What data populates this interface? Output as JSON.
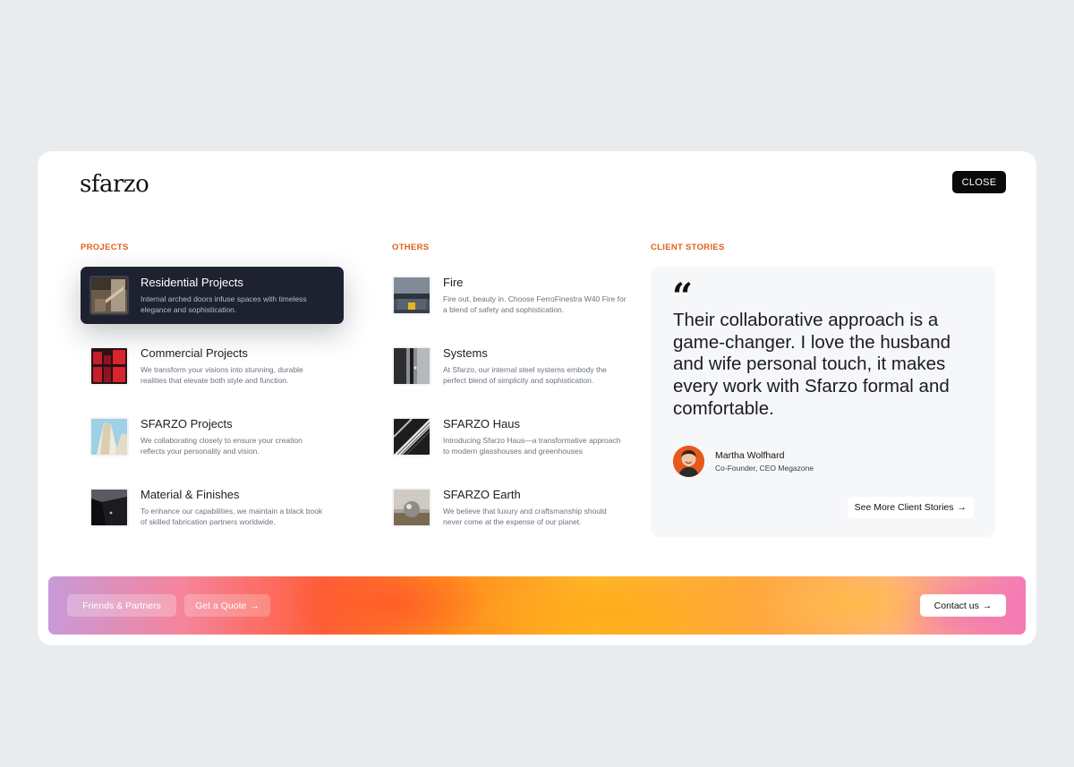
{
  "brand": {
    "logo": "sfarzo"
  },
  "header": {
    "close_label": "CLOSE"
  },
  "projects": {
    "heading": "PROJECTS",
    "items": [
      {
        "title": "Residential Projects",
        "desc": "Internal arched doors infuse spaces with timeless elegance and sophistication.",
        "active": true,
        "icon": "residential-thumb"
      },
      {
        "title": "Commercial Projects",
        "desc": "We transform your visions into stunning, durable realities that elevate both style and function.",
        "icon": "commercial-thumb"
      },
      {
        "title": "SFARZO Projects",
        "desc": "We collaborating closely to ensure your creation reflects your personality and vision.",
        "icon": "sfarzo-projects-thumb"
      },
      {
        "title": "Material & Finishes",
        "desc": "To enhance our capabilities, we maintain a black book of skilled fabrication partners worldwide.",
        "icon": "materials-thumb"
      }
    ]
  },
  "others": {
    "heading": "OTHERS",
    "items": [
      {
        "title": "Fire",
        "desc": "Fire out, beauty in. Choose FerroFinestra W40 Fire for a blend of safety and sophistication.",
        "icon": "fire-thumb"
      },
      {
        "title": "Systems",
        "desc": "At Sfarzo, our internal steel systems embody the perfect blend of simplicity and sophistication.",
        "icon": "systems-thumb"
      },
      {
        "title": "SFARZO Haus",
        "desc": "Introducing Sfarzo Haus—a transformative approach to modern glasshouses and greenhouses",
        "icon": "haus-thumb"
      },
      {
        "title": "SFARZO Earth",
        "desc": "We believe that luxury and craftsmanship should never come at the expense of our planet.",
        "icon": "earth-thumb"
      }
    ]
  },
  "client_stories": {
    "heading": "CLIENT STORIES",
    "quote_mark": "“",
    "quote": "Their collaborative approach is a game-changer. I love the husband and wife personal touch, it makes every work with Sfarzo formal and comfortable.",
    "author_name": "Martha Wolfhard",
    "author_role": "Co-Founder, CEO Megazone",
    "see_more_label": "See More Client Stories"
  },
  "footer": {
    "friends_label": "Friends & Partners",
    "quote_label": "Get a Quote",
    "contact_label": "Contact us"
  },
  "icons": {
    "arrow": "→"
  },
  "colors": {
    "accent": "#e0601a",
    "active_bg": "#1e2230",
    "close_bg": "#0a0a0a"
  }
}
